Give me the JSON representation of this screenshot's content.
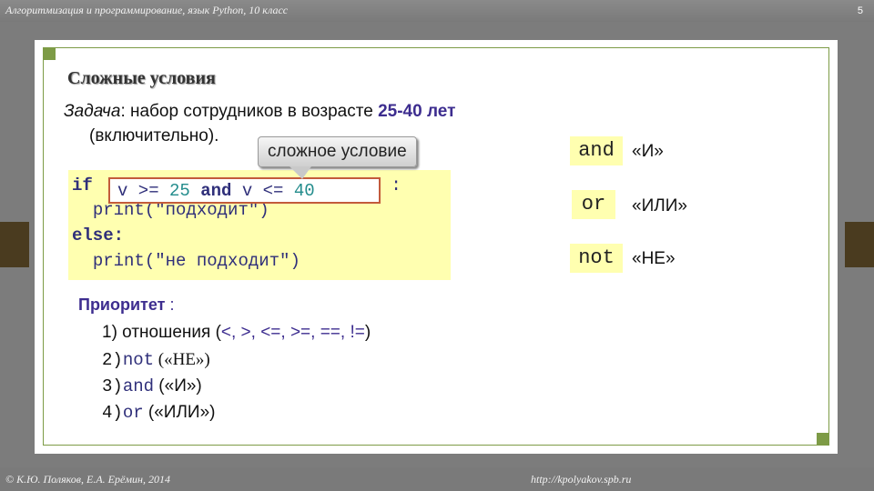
{
  "header": {
    "course": "Алгоритмизация и программирование, язык Python, 10 класс",
    "slide_number": "5"
  },
  "footer": {
    "copyright": "© К.Ю. Поляков, Е.А. Ерёмин, 2014",
    "site": "http://kpolyakov.spb.ru"
  },
  "slide": {
    "title": "Сложные условия",
    "task_label": "Задача",
    "task_text_1": ": набор сотрудников в возрасте ",
    "task_age": "25-40 лет",
    "task_text_2": "(включительно).",
    "callout": "сложное условие"
  },
  "code": {
    "if_kw": "if",
    "condition": {
      "var1": "v",
      "op1": " >= ",
      "num1": "25",
      "and_kw": " and ",
      "var2": "v",
      "op2": " <= ",
      "num2": "40"
    },
    "colon": " :",
    "print1_fn": "print(",
    "print1_str": "\"подходит\"",
    "print1_close": ")",
    "else_kw": "else:",
    "print2_fn": "print(",
    "print2_str": "\"не подходит\"",
    "print2_close": ")"
  },
  "operators": [
    {
      "keyword": "and",
      "meaning": "«И»"
    },
    {
      "keyword": "or",
      "meaning": "«ИЛИ»"
    },
    {
      "keyword": "not",
      "meaning": "«НЕ»"
    }
  ],
  "priority": {
    "label": "Приоритет",
    "colon": " :",
    "item1_prefix": "1) отношения (",
    "item1_ops": "<, >, <=, >=, ==, !=",
    "item1_suffix": ")",
    "item2_num": "2)",
    "item2_kw": "not",
    "item2_desc": " («НЕ»)",
    "item3_num": "3)",
    "item3_kw": "and",
    "item3_desc": " («И»)",
    "item4_num": "4)",
    "item4_kw": "or",
    "item4_desc": " («ИЛИ»)"
  },
  "colors": {
    "frame": "#7d9b46",
    "code_bg": "#ffffb0",
    "accent": "#3d2d8f",
    "highlight_border": "#c35b3b"
  }
}
